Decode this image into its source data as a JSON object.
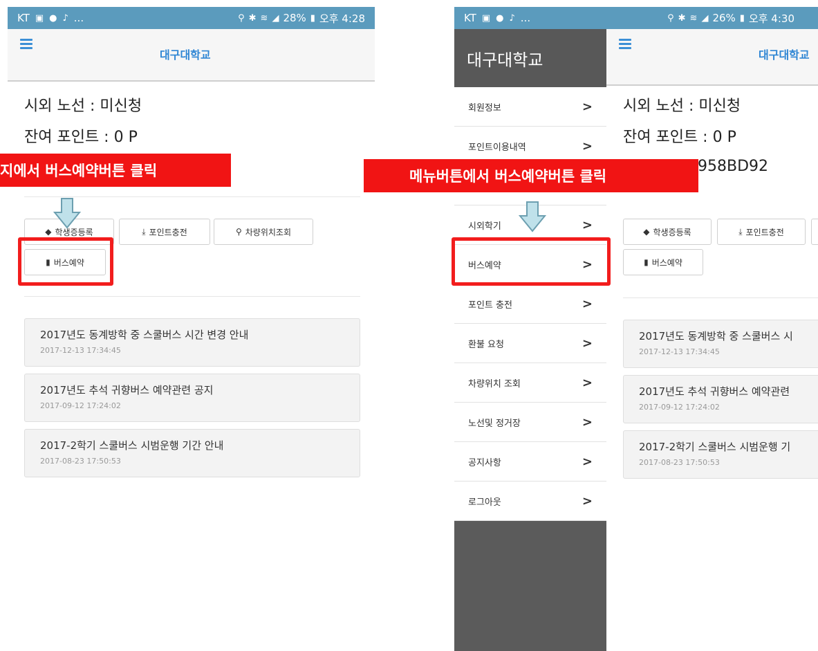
{
  "left": {
    "status": {
      "carrier": "KT",
      "dots": "...",
      "battery": "28%",
      "time": "오후 4:28"
    },
    "app_title": "대구대학교",
    "route_line": "시외 노선 : 미신청",
    "points_line": "잔여 포인트 : 0 P",
    "banner": "지에서 버스예약버튼 클릭",
    "buttons": {
      "student_register": "학생증등록",
      "point_charge": "포인트충전",
      "vehicle_location": "차량위치조회",
      "bus_reserve": "버스예약"
    },
    "notices": [
      {
        "title": "2017년도 동계방학 중 스쿨버스 시간 변경 안내",
        "date": "2017-12-13 17:34:45"
      },
      {
        "title": "2017년도 추석 귀향버스 예약관련 공지",
        "date": "2017-09-12 17:24:02"
      },
      {
        "title": "2017-2학기 스쿨버스 시범운행 기간 안내",
        "date": "2017-08-23 17:50:53"
      }
    ]
  },
  "right": {
    "status": {
      "carrier": "KT",
      "dots": "...",
      "battery": "26%",
      "time": "오후 4:30"
    },
    "app_title": "대구대학교",
    "drawer_title": "대구대학교",
    "route_line": "시외 노선 : 미신청",
    "points_line": "잔여 포인트 : 0 P",
    "code_fragment": "958BD92",
    "banner": "메뉴버튼에서 버스예약버튼 클릭",
    "menu": [
      {
        "label": "회원정보"
      },
      {
        "label": "포인트이용내역"
      },
      {
        "label": ""
      },
      {
        "label": "시외학기"
      },
      {
        "label": "버스예약"
      },
      {
        "label": "포인트 충전"
      },
      {
        "label": "환불 요청"
      },
      {
        "label": "차량위치 조회"
      },
      {
        "label": "노선및 정거장"
      },
      {
        "label": "공지사항"
      },
      {
        "label": "로그아웃"
      }
    ],
    "buttons": {
      "student_register": "학생증등록",
      "point_charge": "포인트충전",
      "bus_reserve": "버스예약"
    },
    "notices": [
      {
        "title": "2017년도 동계방학 중 스쿨버스 시",
        "date": "2017-12-13 17:34:45"
      },
      {
        "title": "2017년도 추석 귀향버스 예약관련",
        "date": "2017-09-12 17:24:02"
      },
      {
        "title": "2017-2학기 스쿨버스 시범운행 기",
        "date": "2017-08-23 17:50:53"
      }
    ]
  },
  "colors": {
    "statusbar": "#5b9bbd",
    "accent_blue": "#2f86d4",
    "highlight_red": "#f11414",
    "drawer_dark": "#5b5b5b"
  },
  "icons": {
    "tag": "tag-icon",
    "download": "download-icon",
    "location": "map-pin-icon",
    "bookmark": "bookmark-icon",
    "chevron": "chevron-right-icon",
    "arrow": "down-arrow-icon",
    "menu": "hamburger-icon"
  }
}
